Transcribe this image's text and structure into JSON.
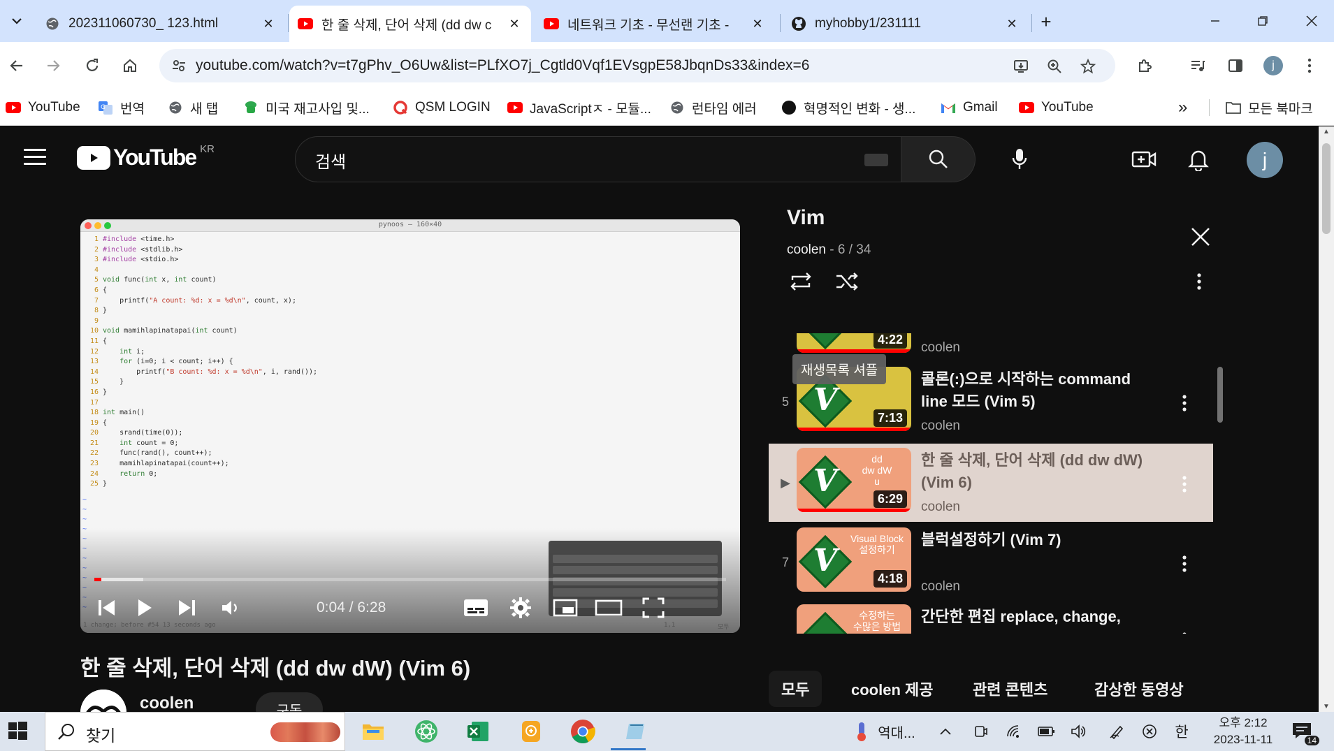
{
  "browser": {
    "tabs": [
      {
        "title": "202311060730_ 123.html",
        "icon": "globe-icon",
        "active": false
      },
      {
        "title": "한 줄 삭제, 단어 삭제 (dd dw c",
        "icon": "youtube-icon",
        "active": true
      },
      {
        "title": "네트워크 기초 - 무선랜 기초 -",
        "icon": "youtube-icon",
        "active": false
      },
      {
        "title": "myhobby1/231111",
        "icon": "github-icon",
        "active": false
      }
    ],
    "url": "youtube.com/watch?v=t7gPhv_O6Uw&list=PLfXO7j_Cgtld0Vqf1EVsgpE58JbqnDs33&index=6",
    "profile_initial": "j",
    "bookmarks": [
      {
        "label": "YouTube",
        "icon": "youtube-icon"
      },
      {
        "label": "번역",
        "icon": "translate-icon"
      },
      {
        "label": "새 탭",
        "icon": "globe-icon"
      },
      {
        "label": "미국 재고사입 및...",
        "icon": "cup-icon"
      },
      {
        "label": "QSM LOGIN",
        "icon": "qsm-icon"
      },
      {
        "label": "JavaScriptㅈ - 모듈...",
        "icon": "youtube-icon"
      },
      {
        "label": "런타임 에러",
        "icon": "globe-icon"
      },
      {
        "label": "혁명적인 변화 - 생...",
        "icon": "black-circle-icon"
      },
      {
        "label": "Gmail",
        "icon": "gmail-icon"
      },
      {
        "label": "YouTube",
        "icon": "youtube-icon"
      }
    ],
    "bookmarks_overflow": "»",
    "all_bookmarks": "모든 북마크"
  },
  "youtube": {
    "logo_text": "YouTube",
    "country_code": "KR",
    "search_placeholder": "검색",
    "avatar_initial": "j",
    "video": {
      "title": "한 줄 삭제, 단어 삭제 (dd dw dW) (Vim 6)",
      "channel": "coolen",
      "subscribe_label": "구독",
      "time_current": "0:04",
      "time_total": "6:28",
      "time_display": "0:04 / 6:28",
      "progress_fraction": 0.0106
    },
    "terminal": {
      "title": "pynoos — 160×40",
      "status_left": "1 change; before #54  13 seconds ago",
      "status_pos": "1,1",
      "status_right": "모두",
      "code_lines": [
        "#include <time.h>",
        "#include <stdlib.h>",
        "#include <stdio.h>",
        "",
        "void func(int x, int count)",
        "{",
        "    printf(\"A count: %d: x = %d\\n\", count, x);",
        "}",
        "",
        "void mamihlapinatapai(int count)",
        "{",
        "    int i;",
        "    for (i=0; i < count; i++) {",
        "        printf(\"B count: %d: x = %d\\n\", i, rand());",
        "    }",
        "}",
        "",
        "int main()",
        "{",
        "    srand(time(0));",
        "    int count = 0;",
        "    func(rand(), count++);",
        "    mamihlapinatapai(count++);",
        "    return 0;",
        "}"
      ]
    },
    "playlist": {
      "title": "Vim",
      "owner": "coolen",
      "position": "6 / 34",
      "shuffle_tooltip": "재생목록 셔플",
      "items": [
        {
          "index": "",
          "title": "",
          "channel": "coolen",
          "duration": "4:22",
          "caption": ""
        },
        {
          "index": "5",
          "title": "콜론(:)으로 시작하는 command line 모드 (Vim 5)",
          "channel": "coolen",
          "duration": "7:13",
          "caption": ""
        },
        {
          "index": "▶",
          "title": "한 줄 삭제, 단어 삭제 (dd dw dW) (Vim 6)",
          "channel": "coolen",
          "duration": "6:29",
          "caption": "dd\ndw dW\nu",
          "current": true
        },
        {
          "index": "7",
          "title": "블럭설정하기 (Vim 7)",
          "channel": "coolen",
          "duration": "4:18",
          "caption": "Visual Block\n설정하기"
        },
        {
          "index": "",
          "title": "간단한 편집 replace, change,",
          "channel": "",
          "duration": "",
          "caption": "수정하는\n수많은 방법"
        }
      ]
    },
    "chips": [
      "모두",
      "coolen 제공",
      "관련 콘텐츠",
      "감상한 동영상"
    ]
  },
  "taskbar": {
    "search_placeholder": "찾기",
    "weather_text": "역대...",
    "ime": "한",
    "time": "오후 2:12",
    "date": "2023-11-11",
    "notification_count": "14"
  },
  "colors": {
    "yt_bg": "#0f0f0f",
    "yt_red": "#ff0000",
    "chrome_tabstrip": "#d3e3fd",
    "current_item_bg": "#e0d4ce",
    "thumb_orange": "#f0a07c",
    "thumb_yellow": "#d9c240"
  }
}
